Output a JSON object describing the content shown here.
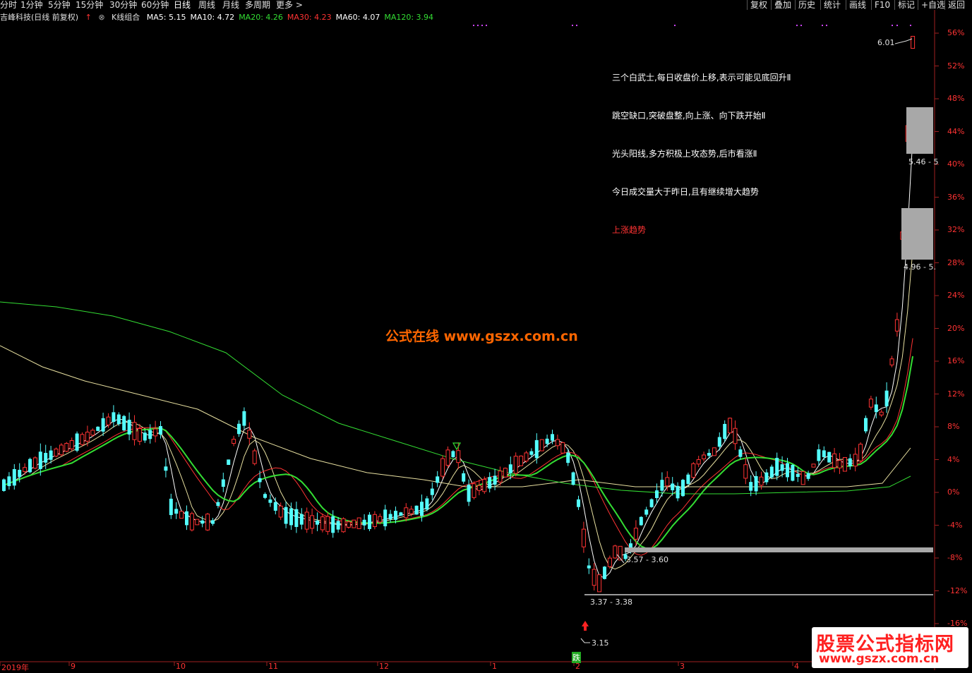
{
  "topbar": {
    "periods": [
      "分时",
      "1分钟",
      "5分钟",
      "15分钟",
      "30分钟",
      "60分钟",
      "日线",
      "周线",
      "月线",
      "多周期",
      "更多 >"
    ],
    "active_period": "日线",
    "right_buttons": [
      "复权",
      "叠加",
      "历史",
      "统计",
      "画线",
      "F10",
      "标记",
      "+自选",
      "返回"
    ]
  },
  "stock": {
    "title": "吉峰科技(日线 前复权)",
    "indicator": "K线组合"
  },
  "ma_legend": [
    {
      "label": "MA5: 5.15",
      "color": "#ffffff"
    },
    {
      "label": "MA10: 4.72",
      "color": "#ffffff"
    },
    {
      "label": "MA20: 4.26",
      "color": "#33dd33"
    },
    {
      "label": "MA30: 4.23",
      "color": "#ff3333"
    },
    {
      "label": "MA60: 4.07",
      "color": "#ffffff"
    },
    {
      "label": "MA120: 3.94",
      "color": "#33dd33"
    }
  ],
  "annotations": [
    {
      "text": "三个白武士,每日收盘价上移,表示可能见底回升Ⅱ",
      "color": "white"
    },
    {
      "text": "跳空缺口,突破盘整,向上涨、向下跌开始Ⅱ",
      "color": "white"
    },
    {
      "text": "光头阳线,多方积极上攻态势,后市看涨Ⅱ",
      "color": "white"
    },
    {
      "text": "今日成交量大于昨日,且有继续增大趋势",
      "color": "white"
    },
    {
      "text": "上涨趋势",
      "color": "red"
    }
  ],
  "price_labels": {
    "high": "6.01",
    "gap_a": "5.46 - 5",
    "gap_b": "4.96 - 5.",
    "gap_c": "3.57 - 3.60",
    "gap_d": "3.37 - 3.38",
    "low": "3.15",
    "down_signal": "跌"
  },
  "y_axis": [
    "56%",
    "52%",
    "48%",
    "44%",
    "40%",
    "36%",
    "32%",
    "28%",
    "24%",
    "20%",
    "16%",
    "12%",
    "8%",
    "4%",
    "0%",
    "-4%",
    "-8%",
    "-12%",
    "-16%"
  ],
  "x_axis": [
    "2019年",
    "9",
    "10",
    "11",
    "12",
    "1",
    "2",
    "3",
    "4"
  ],
  "watermark": "公式在线  www.gszx.com.cn",
  "logo": {
    "line1": "股票公式指标网",
    "line2": "www.gszx.com.cn"
  },
  "colors": {
    "up": "#ff3333",
    "down": "#54ffff",
    "ma_white": "#ffffff",
    "ma_green": "#33dd33",
    "ma_yellow": "#e8e0a0"
  }
}
